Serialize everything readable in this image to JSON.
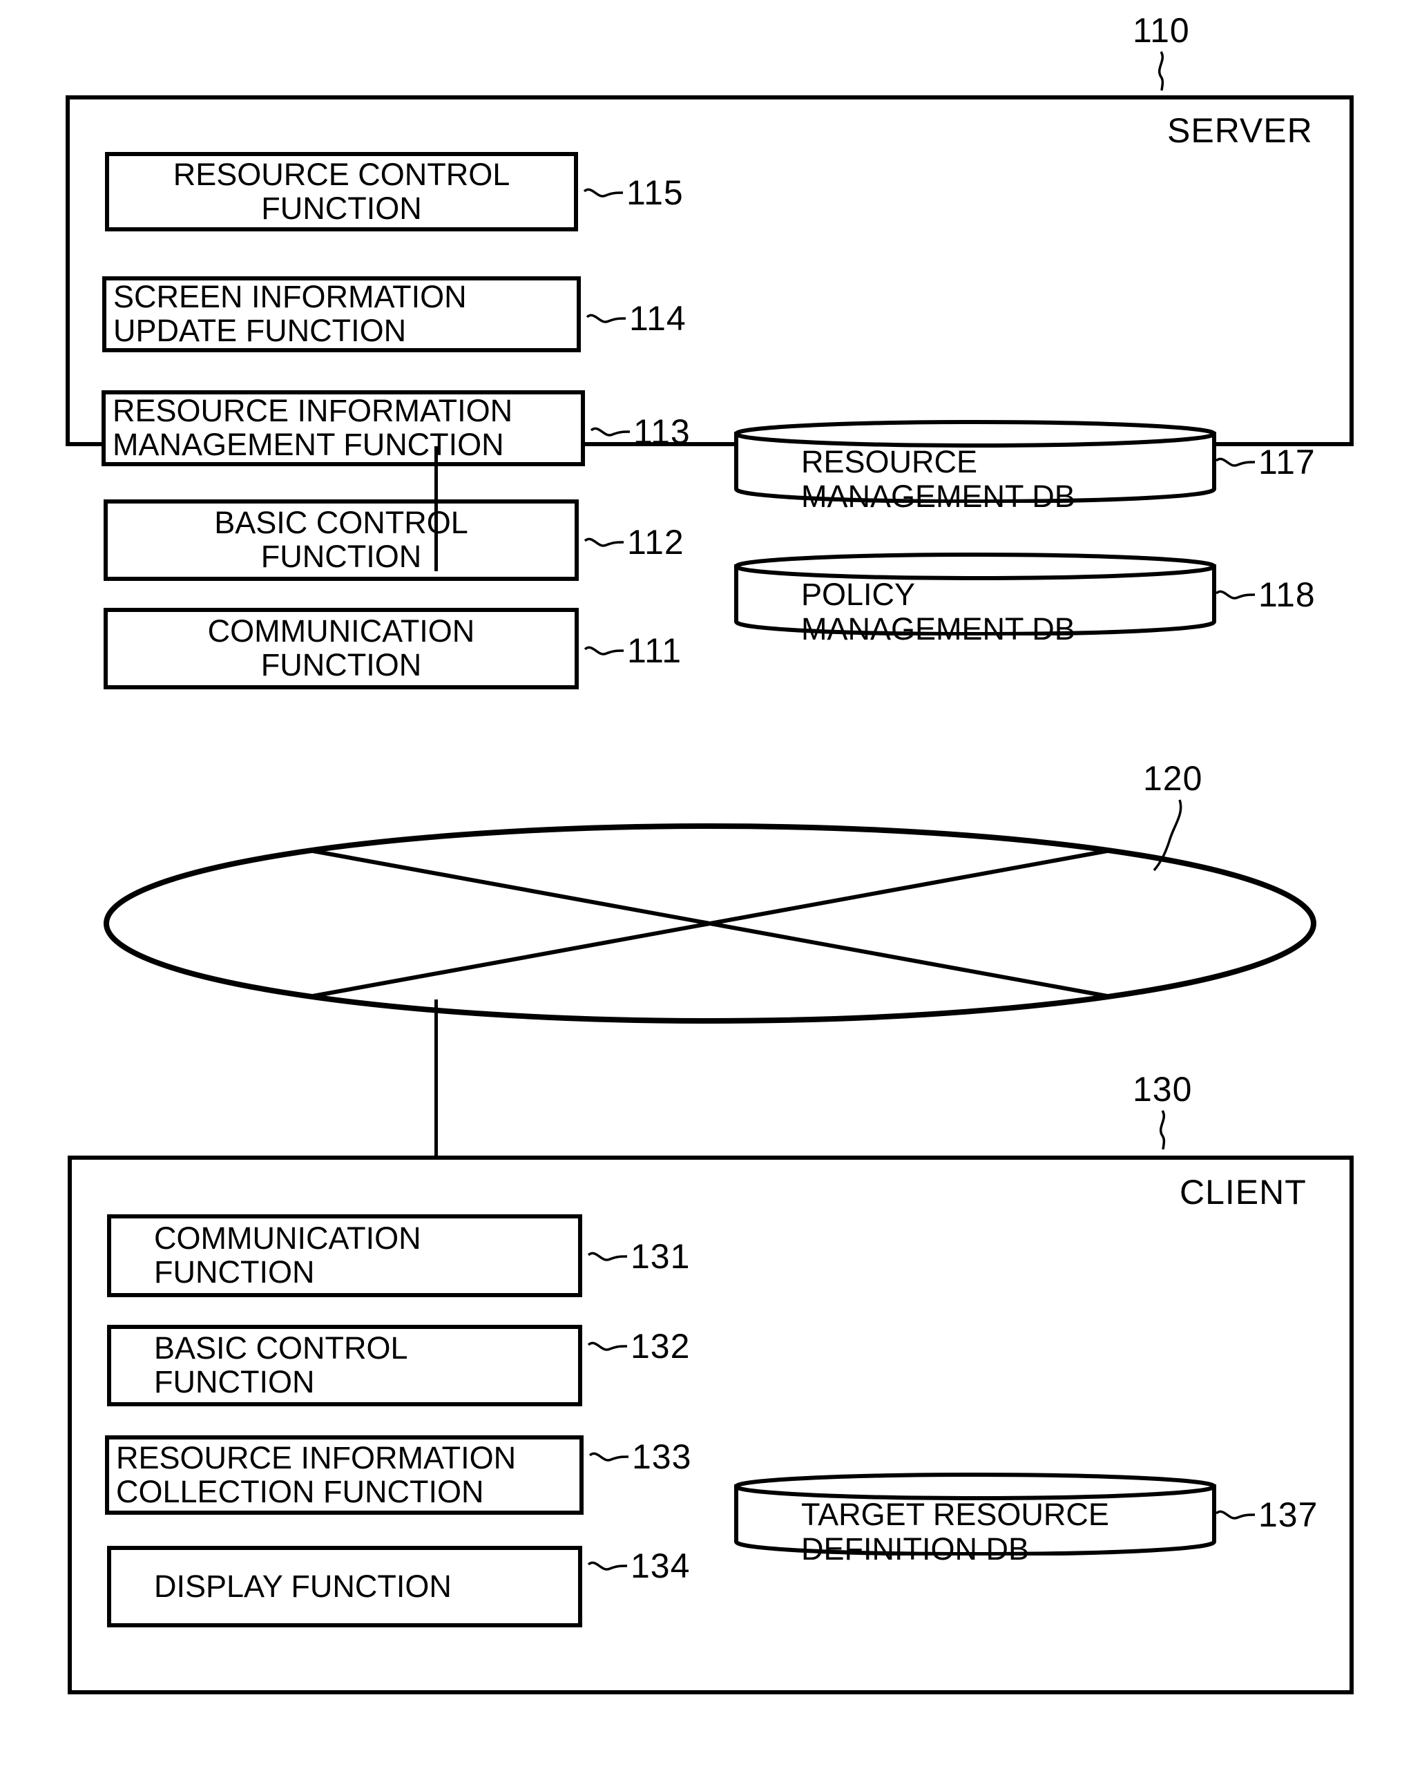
{
  "figure": {
    "type": "patent-system-block-diagram",
    "title": ""
  },
  "server": {
    "label": "SERVER",
    "ref": "110",
    "functions": [
      {
        "ref": "115",
        "label": "RESOURCE CONTROL\nFUNCTION",
        "align": "center"
      },
      {
        "ref": "114",
        "label": "SCREEN INFORMATION\nUPDATE FUNCTION",
        "align": "left"
      },
      {
        "ref": "113",
        "label": "RESOURCE INFORMATION\nMANAGEMENT FUNCTION",
        "align": "left"
      },
      {
        "ref": "112",
        "label": "BASIC CONTROL\nFUNCTION",
        "align": "center"
      },
      {
        "ref": "111",
        "label": "COMMUNICATION\nFUNCTION",
        "align": "center"
      }
    ],
    "databases": [
      {
        "ref": "117",
        "label": "RESOURCE\nMANAGEMENT DB"
      },
      {
        "ref": "118",
        "label": "POLICY\nMANAGEMENT DB"
      }
    ]
  },
  "network": {
    "ref": "120",
    "label": ""
  },
  "client": {
    "label": "CLIENT",
    "ref": "130",
    "functions": [
      {
        "ref": "131",
        "label": "COMMUNICATION\nFUNCTION",
        "align": "center"
      },
      {
        "ref": "132",
        "label": "BASIC CONTROL\nFUNCTION",
        "align": "center"
      },
      {
        "ref": "133",
        "label": "RESOURCE INFORMATION\nCOLLECTION FUNCTION",
        "align": "left"
      },
      {
        "ref": "134",
        "label": "DISPLAY FUNCTION",
        "align": "center"
      }
    ],
    "databases": [
      {
        "ref": "137",
        "label": "TARGET RESOURCE\nDEFINITION DB"
      }
    ]
  },
  "colors": {
    "stroke": "#000000",
    "background": "#ffffff"
  }
}
